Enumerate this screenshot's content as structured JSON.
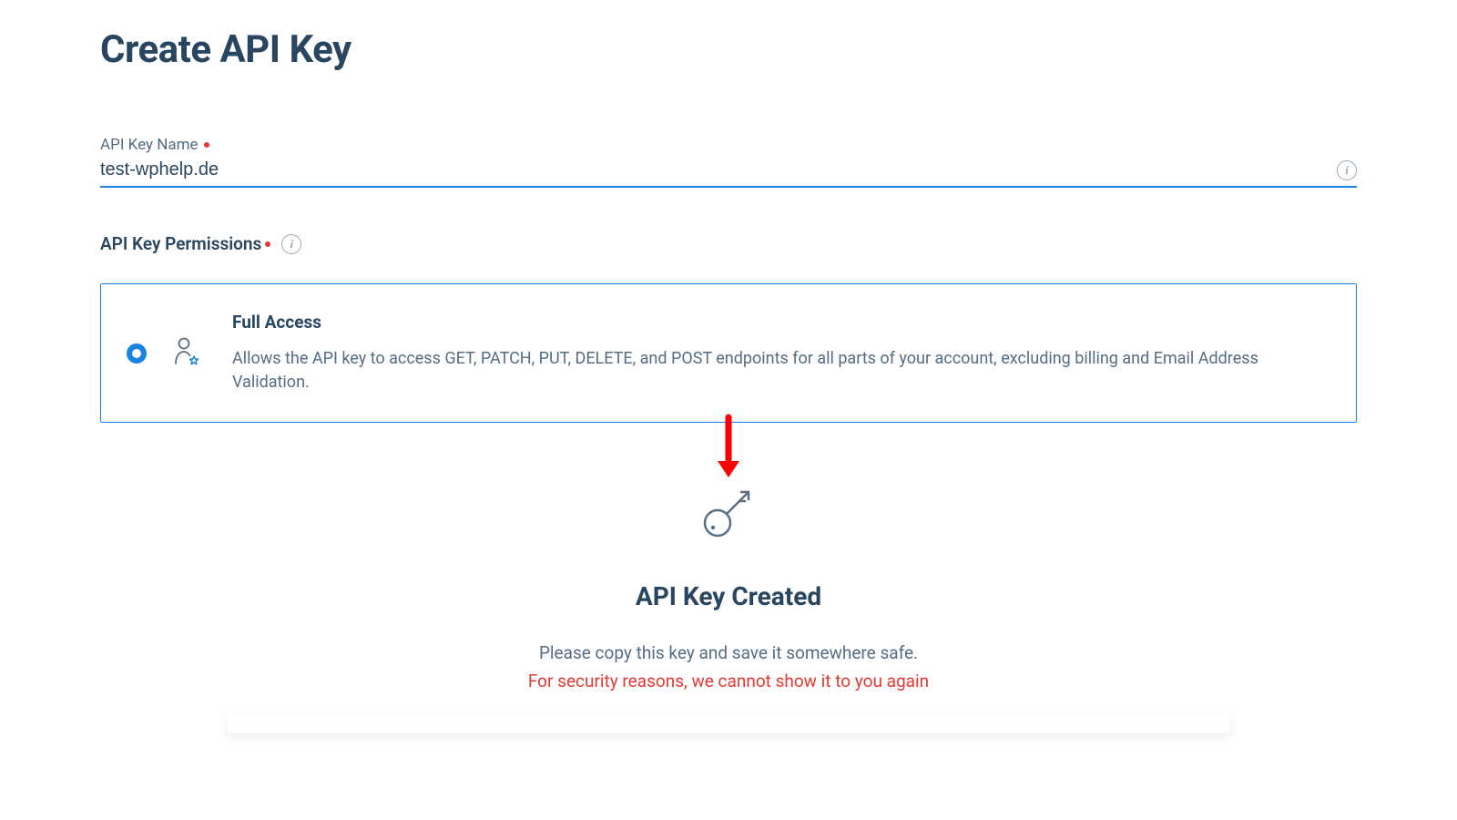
{
  "pageTitle": "Create API Key",
  "nameField": {
    "label": "API Key Name",
    "value": "test-wphelp.de"
  },
  "permissionsLabel": "API Key Permissions",
  "permission": {
    "title": "Full Access",
    "description": "Allows the API key to access GET, PATCH, PUT, DELETE, and POST endpoints for all parts of your account, excluding billing and Email Address Validation."
  },
  "created": {
    "title": "API Key Created",
    "message": "Please copy this key and save it somewhere safe.",
    "warning": "For security reasons, we cannot show it to you again"
  }
}
